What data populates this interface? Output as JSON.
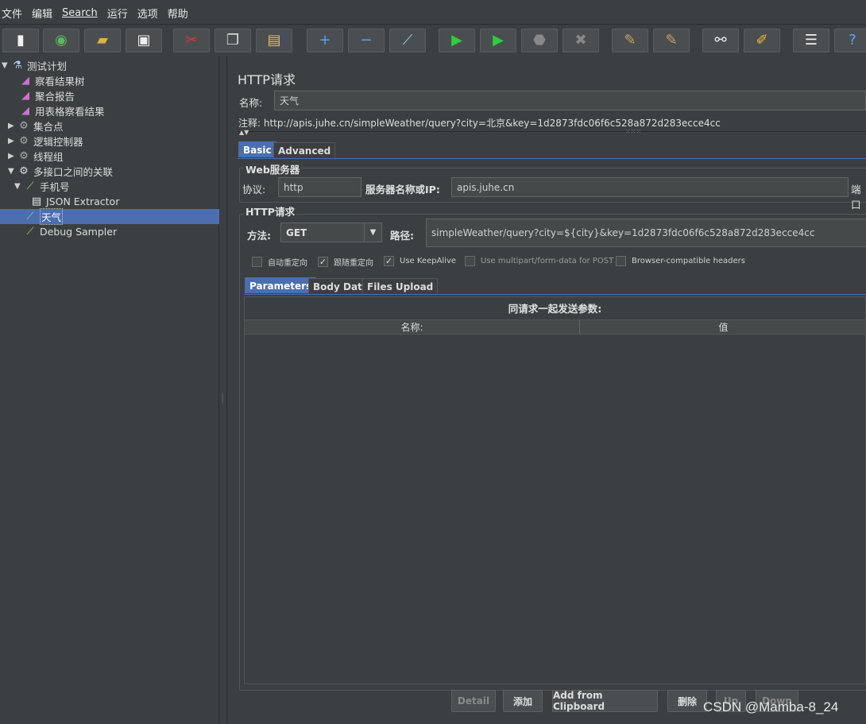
{
  "menu": [
    "文件",
    "编辑",
    "Search",
    "运行",
    "选项",
    "帮助"
  ],
  "toolbar_icons": [
    "new-icon",
    "templates-icon",
    "open-icon",
    "save-icon",
    "cut-icon",
    "copy-icon",
    "paste-icon",
    "expand-icon",
    "collapse-icon",
    "toggle-icon",
    "start-icon",
    "start-no-pause-icon",
    "stop-icon",
    "shutdown-icon",
    "clear-icon",
    "clear-all-icon",
    "search-icon",
    "reset-search-icon",
    "function-helper-icon",
    "help-icon"
  ],
  "tree": [
    {
      "label": "测试计划",
      "expanded": "▼"
    },
    {
      "label": "察看结果树"
    },
    {
      "label": "聚合报告"
    },
    {
      "label": "用表格察看结果"
    },
    {
      "label": "集合点",
      "expanded": "▶"
    },
    {
      "label": "逻辑控制器",
      "expanded": "▶"
    },
    {
      "label": "线程组",
      "expanded": "▶"
    },
    {
      "label": "多接口之间的关联",
      "expanded": "▼"
    },
    {
      "label": "手机号",
      "expanded": "▼"
    },
    {
      "label": "JSON Extractor"
    },
    {
      "label": "天气"
    },
    {
      "label": "Debug Sampler"
    }
  ],
  "panel": {
    "title": "HTTP请求",
    "name_label": "名称:",
    "name_value": "天气",
    "comment": "注释: http://apis.juhe.cn/simpleWeather/query?city=北京&key=1d2873fdc06f6c528a872d283ecce4cc",
    "tabs": [
      "Basic",
      "Advanced"
    ],
    "web_server": {
      "group_title": "Web服务器",
      "protocol_label": "协议:",
      "protocol_value": "http",
      "server_label": "服务器名称或IP:",
      "server_value": "apis.juhe.cn",
      "port_label": "端口"
    },
    "http_request": {
      "group_title": "HTTP请求",
      "method_label": "方法:",
      "method_value": "GET",
      "path_label": "路径:",
      "path_value": "simpleWeather/query?city=${city}&key=1d2873fdc06f6c528a872d283ecce4cc"
    },
    "checkboxes": [
      {
        "label": "自动重定向",
        "checked": false,
        "mark": ""
      },
      {
        "label": "跟随重定向",
        "checked": true,
        "mark": "✓"
      },
      {
        "label": "Use KeepAlive",
        "checked": true,
        "mark": "✓"
      },
      {
        "label": "Use multipart/form-data for POST",
        "checked": false,
        "mark": ""
      },
      {
        "label": "Browser-compatible headers",
        "checked": false,
        "mark": ""
      }
    ],
    "subtabs": [
      "Parameters",
      "Body Data",
      "Files Upload"
    ],
    "params_caption": "同请求一起发送参数:",
    "columns": [
      "名称:",
      "值"
    ],
    "buttons": [
      "Detail",
      "添加",
      "Add from Clipboard",
      "删除",
      "Up",
      "Down"
    ]
  },
  "watermark": "CSDN @Mamba-8_24"
}
